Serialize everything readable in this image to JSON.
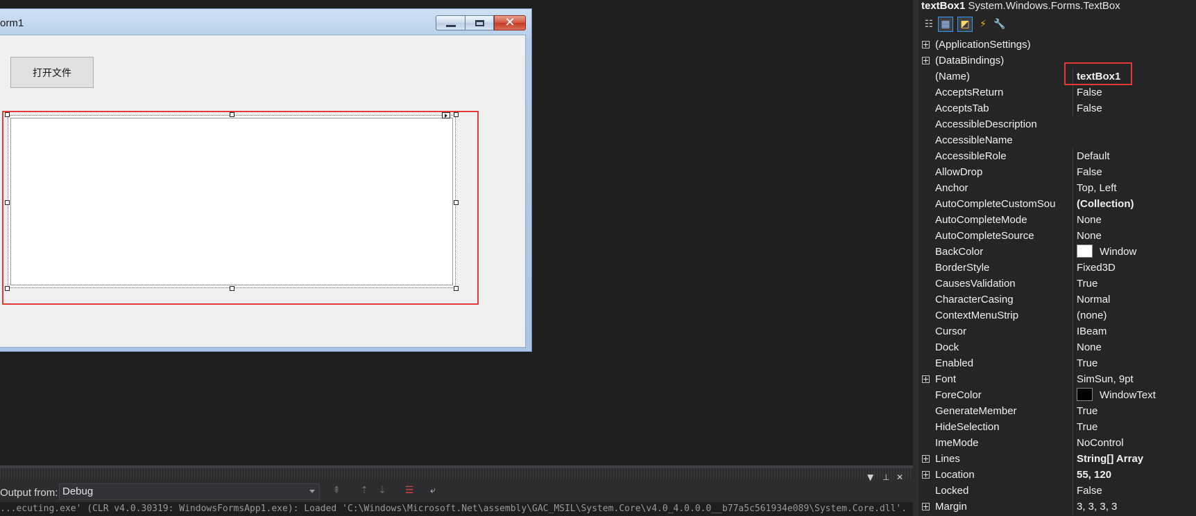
{
  "form": {
    "title": "orm1",
    "open_file_button": "打开文件"
  },
  "output": {
    "from_label": "Output from:",
    "source": "Debug",
    "text": "...ecuting.exe' (CLR v4.0.30319: WindowsFormsApp1.exe): Loaded 'C:\\Windows\\Microsoft.Net\\assembly\\GAC_MSIL\\System.Core\\v4.0_4.0.0.0__b77a5c561934e089\\System.Core.dll'. Skipped loading symbols."
  },
  "properties": {
    "object_name": "textBox1",
    "object_type": "System.Windows.Forms.TextBox",
    "rows": [
      {
        "name": "(ApplicationSettings)",
        "value": "",
        "expandable": true
      },
      {
        "name": "(DataBindings)",
        "value": "",
        "expandable": true
      },
      {
        "name": "(Name)",
        "value": "textBox1",
        "bold": true
      },
      {
        "name": "AcceptsReturn",
        "value": "False"
      },
      {
        "name": "AcceptsTab",
        "value": "False"
      },
      {
        "name": "AccessibleDescription",
        "value": ""
      },
      {
        "name": "AccessibleName",
        "value": ""
      },
      {
        "name": "AccessibleRole",
        "value": "Default"
      },
      {
        "name": "AllowDrop",
        "value": "False"
      },
      {
        "name": "Anchor",
        "value": "Top, Left"
      },
      {
        "name": "AutoCompleteCustomSou",
        "value": "(Collection)",
        "bold": true
      },
      {
        "name": "AutoCompleteMode",
        "value": "None"
      },
      {
        "name": "AutoCompleteSource",
        "value": "None"
      },
      {
        "name": "BackColor",
        "value": "Window",
        "swatch": "#ffffff"
      },
      {
        "name": "BorderStyle",
        "value": "Fixed3D"
      },
      {
        "name": "CausesValidation",
        "value": "True"
      },
      {
        "name": "CharacterCasing",
        "value": "Normal"
      },
      {
        "name": "ContextMenuStrip",
        "value": "(none)"
      },
      {
        "name": "Cursor",
        "value": "IBeam"
      },
      {
        "name": "Dock",
        "value": "None"
      },
      {
        "name": "Enabled",
        "value": "True"
      },
      {
        "name": "Font",
        "value": "SimSun, 9pt",
        "expandable": true
      },
      {
        "name": "ForeColor",
        "value": "WindowText",
        "swatch": "#000000"
      },
      {
        "name": "GenerateMember",
        "value": "True"
      },
      {
        "name": "HideSelection",
        "value": "True"
      },
      {
        "name": "ImeMode",
        "value": "NoControl"
      },
      {
        "name": "Lines",
        "value": "String[] Array",
        "expandable": true,
        "bold": true
      },
      {
        "name": "Location",
        "value": "55, 120",
        "expandable": true,
        "bold": true
      },
      {
        "name": "Locked",
        "value": "False"
      },
      {
        "name": "Margin",
        "value": "3, 3, 3, 3",
        "expandable": true
      }
    ]
  },
  "icons": {
    "categorized": "categorized-icon",
    "alphabetical": "alphabetical-icon",
    "properties": "properties-icon",
    "events": "events-icon",
    "property_pages": "property-pages-icon"
  },
  "colors": {
    "highlight": "#e53935",
    "dark_bg": "#1e1e1e",
    "panel_bg": "#252526"
  }
}
